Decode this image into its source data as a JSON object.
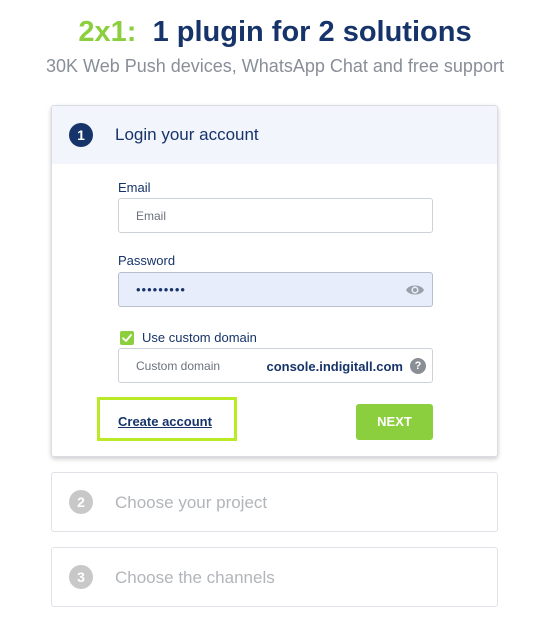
{
  "header": {
    "accent": "2x1:",
    "title": "1 plugin for 2 solutions",
    "subtitle": "30K Web Push devices, WhatsApp Chat and free support"
  },
  "login": {
    "step": "1",
    "title": "Login your account",
    "email_label": "Email",
    "email_placeholder": "Email",
    "password_label": "Password",
    "password_value": "•••••••••",
    "custom_domain_checkbox": "Use custom domain",
    "custom_domain_checked": true,
    "custom_domain_placeholder": "Custom domain",
    "custom_domain_value": "console.indigitall.com",
    "help_icon": "?",
    "create_account": "Create account",
    "next_button": "NEXT"
  },
  "steps": [
    {
      "number": "2",
      "title": "Choose your project"
    },
    {
      "number": "3",
      "title": "Choose the channels"
    }
  ],
  "icons": {
    "password_toggle": "eye-icon",
    "help": "question-mark-icon",
    "checkbox": "checkmark-icon"
  },
  "colors": {
    "brand_navy": "#17346a",
    "accent_green": "#8ccf3e",
    "highlight_box": "#b9ea25",
    "muted_text": "#888f98"
  }
}
